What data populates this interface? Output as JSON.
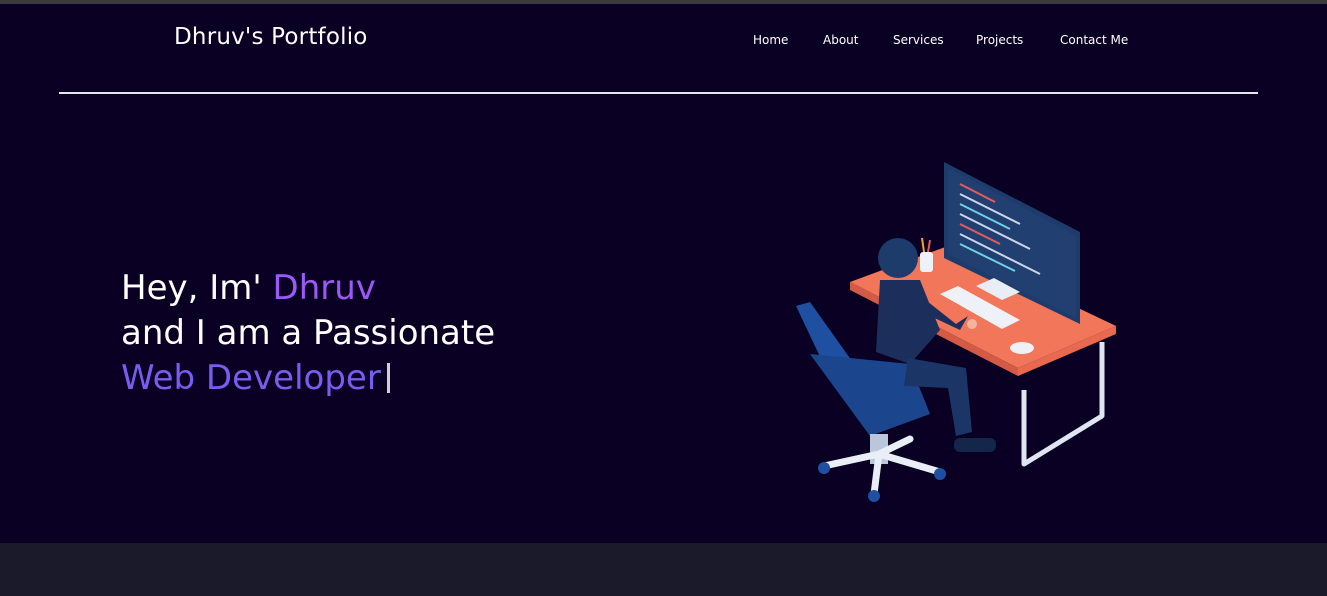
{
  "brand": {
    "title": "Dhruv's Portfolio"
  },
  "nav": {
    "items": [
      {
        "label": "Home"
      },
      {
        "label": "About"
      },
      {
        "label": "Services"
      },
      {
        "label": "Projects"
      },
      {
        "label": "Contact Me"
      }
    ]
  },
  "hero": {
    "line1_prefix": "Hey, Im' ",
    "line1_name": "Dhruv",
    "line2": "and I am a Passionate",
    "line3_role": "Web Developer"
  },
  "colors": {
    "background": "#0a0023",
    "accent_name": "#9b59f6",
    "accent_role": "#7b5cf0",
    "text": "#ffffff"
  },
  "illustration": {
    "icon": "developer-at-desk-illustration"
  }
}
